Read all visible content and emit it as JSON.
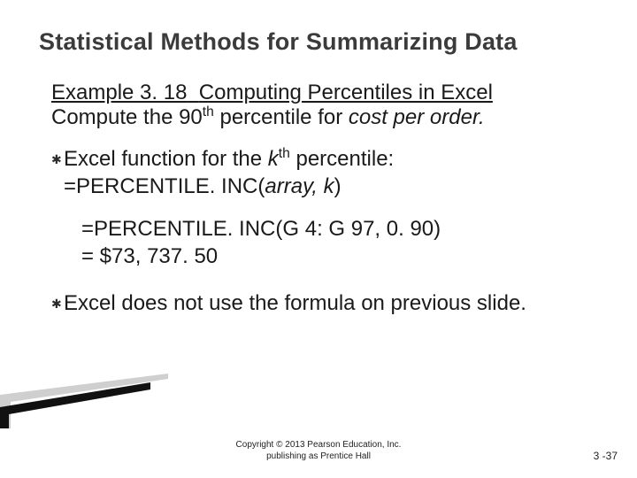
{
  "title": "Statistical Methods for Summarizing Data",
  "example": {
    "label_prefix": "Example 3. 18",
    "label_rest": "Computing Percentiles in Excel",
    "prompt_pre": "Compute the 90",
    "prompt_sup": "th",
    "prompt_mid": " percentile for ",
    "prompt_italic": "cost per order.",
    "prompt_post": ""
  },
  "bullet1": {
    "line1_pre": "Excel function for the ",
    "line1_k": "k",
    "line1_sup": "th",
    "line1_post": " percentile:",
    "line2_a": "=PERCENTILE. INC(",
    "line2_b": "array, k",
    "line2_c": ")"
  },
  "indent": {
    "line1": "=PERCENTILE. INC(G 4: G 97, 0. 90)",
    "line2": "= $73, 737. 50"
  },
  "bullet2": {
    "text": "Excel does not use the formula on previous slide."
  },
  "footer": {
    "copyright_line1": "Copyright © 2013 Pearson Education, Inc.",
    "copyright_line2": "publishing as Prentice Hall",
    "page": "3 -37"
  },
  "icons": {
    "bullet": "✱"
  }
}
